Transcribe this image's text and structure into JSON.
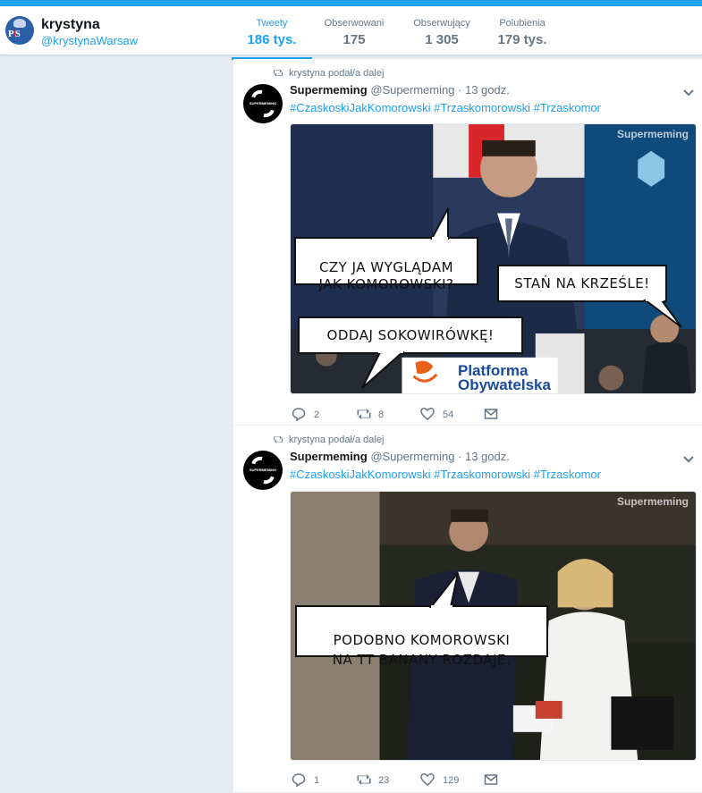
{
  "profile": {
    "name": "krystyna",
    "handle": "@krystynaWarsaw"
  },
  "stats": [
    {
      "label": "Tweety",
      "value": "186 tys."
    },
    {
      "label": "Obserwowani",
      "value": "175"
    },
    {
      "label": "Obserwujący",
      "value": "1 305"
    },
    {
      "label": "Polubienia",
      "value": "179 tys."
    }
  ],
  "colors": {
    "accent": "#1da1f2",
    "text_secondary": "#657786",
    "background": "#e6ecf0"
  },
  "tweets": [
    {
      "context": "krystyna podał/a dalej",
      "author": "Supermeming",
      "handle_time": "@Supermeming · 13 godz.",
      "hashtags": "#CzaskoskiJakKomorowski #Trzaskomorowski #Trzaskomor",
      "watermark": "Supermeming",
      "bubbles": [
        "CZY JA WYGLĄDAM\nJAK KOMOROWSKI?",
        "STAŃ NA KRZEŚLE!",
        "ODDAJ SOKOWIRÓWKĘ!"
      ],
      "logo_line1": "Platforma",
      "logo_line2": "Obywatelska",
      "replies": "2",
      "retweets": "8",
      "likes": "54"
    },
    {
      "context": "krystyna podał/a dalej",
      "author": "Supermeming",
      "handle_time": "@Supermeming · 13 godz.",
      "hashtags": "#CzaskoskiJakKomorowski #Trzaskomorowski #Trzaskomor",
      "watermark": "Supermeming",
      "bubbles": [
        "PODOBNO KOMOROWSKI\nNA TT BANANY ROZDAJE."
      ],
      "replies": "1",
      "retweets": "23",
      "likes": "129"
    }
  ]
}
